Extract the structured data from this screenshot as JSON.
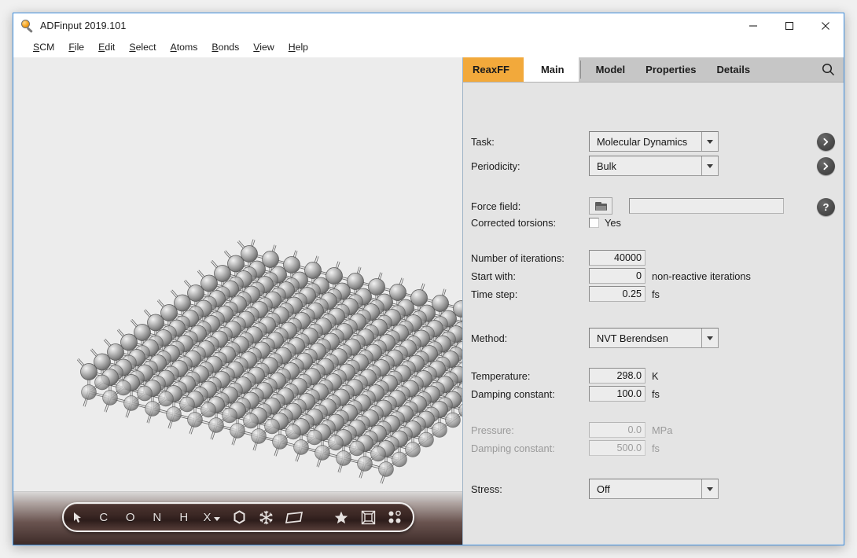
{
  "window": {
    "title": "ADFinput 2019.101",
    "icon": "magnifier-icon",
    "controls": {
      "minimize": "─",
      "maximize": "□",
      "close": "✕"
    }
  },
  "menubar": {
    "items": [
      {
        "accel": "S",
        "rest": "CM"
      },
      {
        "accel": "F",
        "rest": "ile"
      },
      {
        "accel": "E",
        "rest": "dit"
      },
      {
        "accel": "S",
        "rest": "elect"
      },
      {
        "accel": "A",
        "rest": "toms"
      },
      {
        "accel": "B",
        "rest": "onds"
      },
      {
        "accel": "V",
        "rest": "iew"
      },
      {
        "accel": "H",
        "rest": "elp"
      }
    ]
  },
  "tabbar": {
    "module": "ReaxFF",
    "active": "Main",
    "tabs": [
      "Model",
      "Properties",
      "Details"
    ],
    "search_icon": "search-icon",
    "module_color": "#f2a93b"
  },
  "viewport": {
    "structure_description": "gray-sphere periodic slab with bonds",
    "atom_color": "#9a9a9a",
    "background": "#ececec"
  },
  "atom_toolbar": {
    "items": [
      {
        "name": "select-cursor",
        "glyph": "➤",
        "type": "icon"
      },
      {
        "name": "atom-c",
        "glyph": "C",
        "type": "letter"
      },
      {
        "name": "atom-o",
        "glyph": "O",
        "type": "letter"
      },
      {
        "name": "atom-n",
        "glyph": "N",
        "type": "letter"
      },
      {
        "name": "atom-h",
        "glyph": "H",
        "type": "letter"
      },
      {
        "name": "atom-x-dropdown",
        "glyph": "X",
        "type": "letter-caret"
      },
      {
        "name": "benzene-ring",
        "glyph": "⬡",
        "type": "icon"
      },
      {
        "name": "snowflake",
        "glyph": "❄",
        "type": "icon"
      },
      {
        "name": "plane-slab",
        "glyph": "▱",
        "type": "icon"
      },
      {
        "name": "star",
        "glyph": "★",
        "type": "icon"
      },
      {
        "name": "boxed-frame",
        "glyph": "⧉",
        "type": "icon"
      },
      {
        "name": "four-dots",
        "glyph": "⁙",
        "type": "icon"
      }
    ]
  },
  "form": {
    "task": {
      "label": "Task:",
      "value": "Molecular Dynamics"
    },
    "periodicity": {
      "label": "Periodicity:",
      "value": "Bulk"
    },
    "force_field": {
      "label": "Force field:",
      "value": "",
      "browse_icon": "folder-icon",
      "help_icon": "question-icon"
    },
    "corrected_torsions": {
      "label": "Corrected torsions:",
      "checkbox_label": "Yes",
      "checked": false
    },
    "iterations": {
      "label": "Number of iterations:",
      "value": "40000"
    },
    "start_with": {
      "label": "Start with:",
      "value": "0",
      "suffix": "non-reactive iterations"
    },
    "time_step": {
      "label": "Time step:",
      "value": "0.25",
      "unit": "fs"
    },
    "method": {
      "label": "Method:",
      "value": "NVT Berendsen"
    },
    "temperature": {
      "label": "Temperature:",
      "value": "298.0",
      "unit": "K"
    },
    "damping_constant_t": {
      "label": "Damping constant:",
      "value": "100.0",
      "unit": "fs"
    },
    "pressure": {
      "label": "Pressure:",
      "value": "0.0",
      "unit": "MPa",
      "disabled": true
    },
    "damping_constant_p": {
      "label": "Damping constant:",
      "value": "500.0",
      "unit": "fs",
      "disabled": true
    },
    "stress": {
      "label": "Stress:",
      "value": "Off"
    }
  }
}
